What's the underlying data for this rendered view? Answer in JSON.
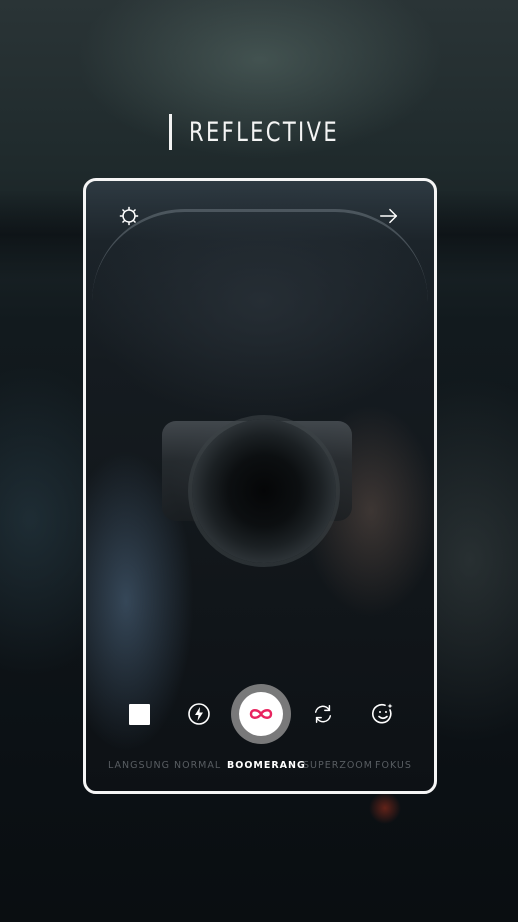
{
  "brand": {
    "title": "REFLECTIVE"
  },
  "camera": {
    "top_bar": {
      "settings_icon": "gear-icon",
      "next_icon": "arrow-right-icon"
    },
    "controls": {
      "gallery_icon": "square-icon",
      "flash_icon": "flash-icon",
      "shutter_icon": "infinity-icon",
      "flip_icon": "flip-camera-icon",
      "effects_icon": "face-sparkle-icon"
    },
    "modes": [
      "LANGSUNG",
      "NORMAL",
      "BOOMERANG",
      "SUPERZOOM",
      "FOKUS"
    ],
    "active_mode": "BOOMERANG"
  },
  "colors": {
    "accent": "#e8245f",
    "frame": "#f5f5f5",
    "active_mode": "#ffffff",
    "inactive_mode": "#8c9196"
  }
}
